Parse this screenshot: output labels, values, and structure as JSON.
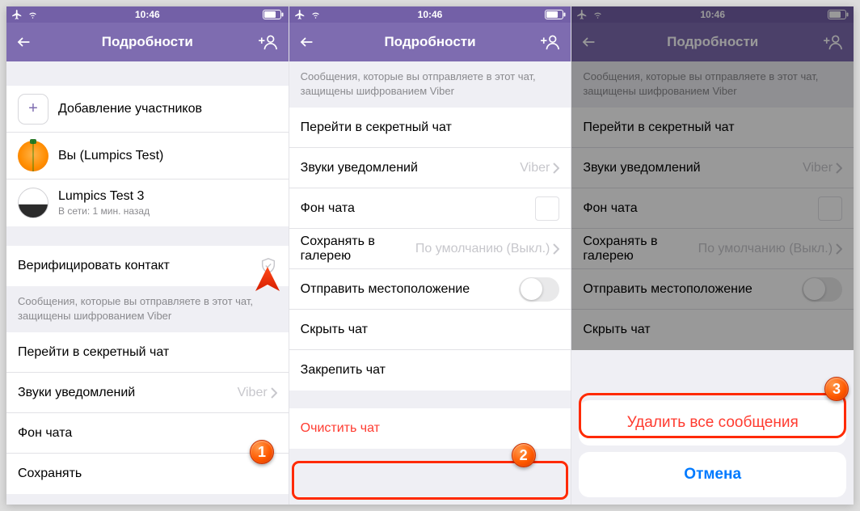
{
  "status": {
    "time": "10:46"
  },
  "nav": {
    "title": "Подробности"
  },
  "phone1": {
    "add_participants": "Добавление участников",
    "you": "Вы (Lumpics Test)",
    "contact_name": "Lumpics Test 3",
    "contact_status": "В сети: 1 мин. назад",
    "verify": "Верифицировать контакт",
    "note": "Сообщения, которые вы отправляете в этот чат, защищены шифрованием Viber",
    "secret": "Перейти в секретный чат",
    "sounds": "Звуки уведомлений",
    "sounds_value": "Viber",
    "background": "Фон чата",
    "save_partial": "Сохранять"
  },
  "common": {
    "note": "Сообщения, которые вы отправляете в этот чат, защищены шифрованием Viber",
    "secret": "Перейти в секретный чат",
    "sounds": "Звуки уведомлений",
    "sounds_value": "Viber",
    "background": "Фон чата",
    "save_gallery": "Сохранять в галерею",
    "save_gallery_value": "По умолчанию (Выкл.)",
    "send_location": "Отправить местоположение",
    "hide_chat": "Скрыть чат",
    "pin_chat": "Закрепить чат",
    "clear_chat": "Очистить чат"
  },
  "sheet": {
    "delete_all": "Удалить все сообщения",
    "cancel": "Отмена"
  },
  "badges": {
    "b1": "1",
    "b2": "2",
    "b3": "3"
  }
}
